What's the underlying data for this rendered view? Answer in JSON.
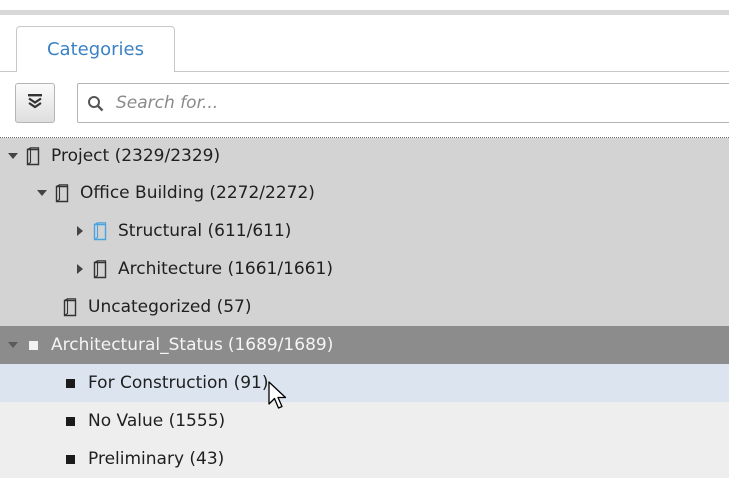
{
  "tabs": {
    "categories": "Categories"
  },
  "search": {
    "placeholder": "Search for..."
  },
  "tree": {
    "project": "Project (2329/2329)",
    "office_building": "Office Building (2272/2272)",
    "structural": "Structural (611/611)",
    "architecture": "Architecture (1661/1661)",
    "uncategorized": "Uncategorized (57)",
    "architectural_status_name": "Architectural_Status",
    "architectural_status_count": "(1689/1689)",
    "for_construction": "For Construction (91)",
    "no_value": "No Value (1555)",
    "preliminary": "Preliminary  (43)"
  },
  "colors": {
    "tab_text": "#3b82c4",
    "structural_icon": "#4aa3e0",
    "category_row": "#d3d3d3",
    "property_row": "#8c8c8c",
    "selected_row": "#dce5ef"
  }
}
